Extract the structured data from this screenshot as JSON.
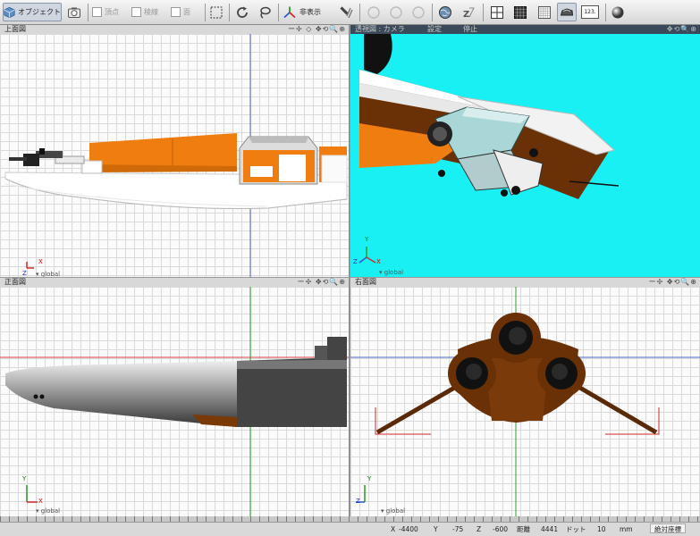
{
  "toolbar": {
    "object_label": "オブジェクト",
    "vertex_label": "頂点",
    "edge_label": "稜線",
    "face_label": "面",
    "hide_label": "非表示",
    "coord_label": "123."
  },
  "viewports": {
    "top": {
      "title": "上面図",
      "controls": "ー✢ ◇  ✥⟲🔍⊕",
      "axis_x": "X",
      "axis_z": "Z",
      "space": "global"
    },
    "perspective": {
      "title": "透視図 : カメラ",
      "tab2": "設定",
      "tab3": "停止",
      "controls": "✥⟲🔍⊕",
      "axis_y": "Y",
      "axis_z": "Z",
      "axis_x": "X",
      "space": "global"
    },
    "front": {
      "title": "正面図",
      "controls": "ー✢  ✥⟲🔍⊕",
      "axis_y": "Y",
      "axis_x": "X",
      "space": "global"
    },
    "side": {
      "title": "右面図",
      "controls": "ー✢  ✥⟲🔍⊕",
      "axis_y": "Y",
      "axis_z": "Z",
      "space": "global"
    }
  },
  "status": {
    "x_label": "X",
    "x_value": "-4400",
    "y_label": "Y",
    "y_value": "-75",
    "z_label": "Z",
    "z_value": "-600",
    "dist_label": "距離",
    "dist_value": "4441",
    "dot_label": "ドット",
    "dot_value": "10",
    "unit": "mm",
    "abs_coord": "絶対座標"
  },
  "colors": {
    "orange": "#f07d0f",
    "cyan": "#19f0f4",
    "brown": "#5a2a08"
  }
}
